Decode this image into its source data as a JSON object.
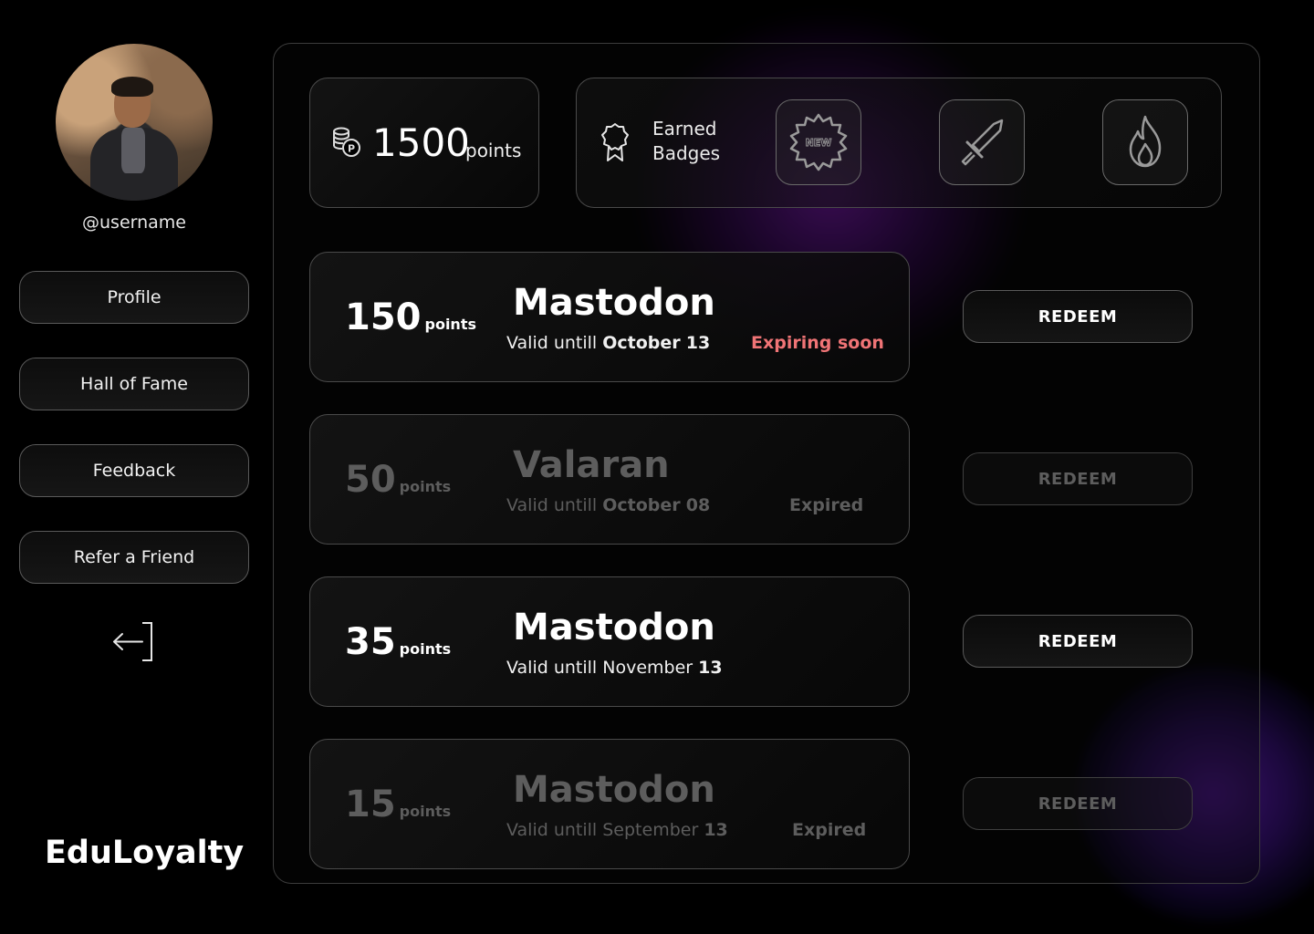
{
  "sidebar": {
    "username": "@username",
    "nav": [
      "Profile",
      "Hall of Fame",
      "Feedback",
      "Refer a Friend"
    ],
    "brand": "EduLoyalty"
  },
  "summary": {
    "points_value": "1500",
    "points_unit": "points",
    "badges_label": "Earned Badges",
    "badges": [
      {
        "icon": "new-badge-icon",
        "text": "NEW"
      },
      {
        "icon": "sword-icon"
      },
      {
        "icon": "flame-icon"
      }
    ]
  },
  "offers": [
    {
      "points": "150",
      "unit": "points",
      "title": "Mastodon",
      "valid_prefix": "Valid untill",
      "valid_month": "October",
      "valid_day": "13",
      "status": "Expiring soon",
      "status_color": "#f07476",
      "redeem": "REDEEM",
      "active": true
    },
    {
      "points": "50",
      "unit": "points",
      "title": "Valaran",
      "valid_prefix": "Valid untill",
      "valid_month": "October",
      "valid_day": "08",
      "status": "Expired",
      "redeem": "REDEEM",
      "active": false
    },
    {
      "points": "35",
      "unit": "points",
      "title": "Mastodon",
      "valid_prefix": "Valid untill",
      "valid_month": "November",
      "valid_day": "13",
      "status": "",
      "redeem": "REDEEM",
      "active": true
    },
    {
      "points": "15",
      "unit": "points",
      "title": "Mastodon",
      "valid_prefix": "Valid untill",
      "valid_month": "September",
      "valid_day": "13",
      "status": "Expired",
      "redeem": "REDEEM",
      "active": false
    }
  ],
  "colors": {
    "accent_glow": "#6e14a0",
    "expiring": "#f07476",
    "disabled": "#5d5d5d"
  }
}
